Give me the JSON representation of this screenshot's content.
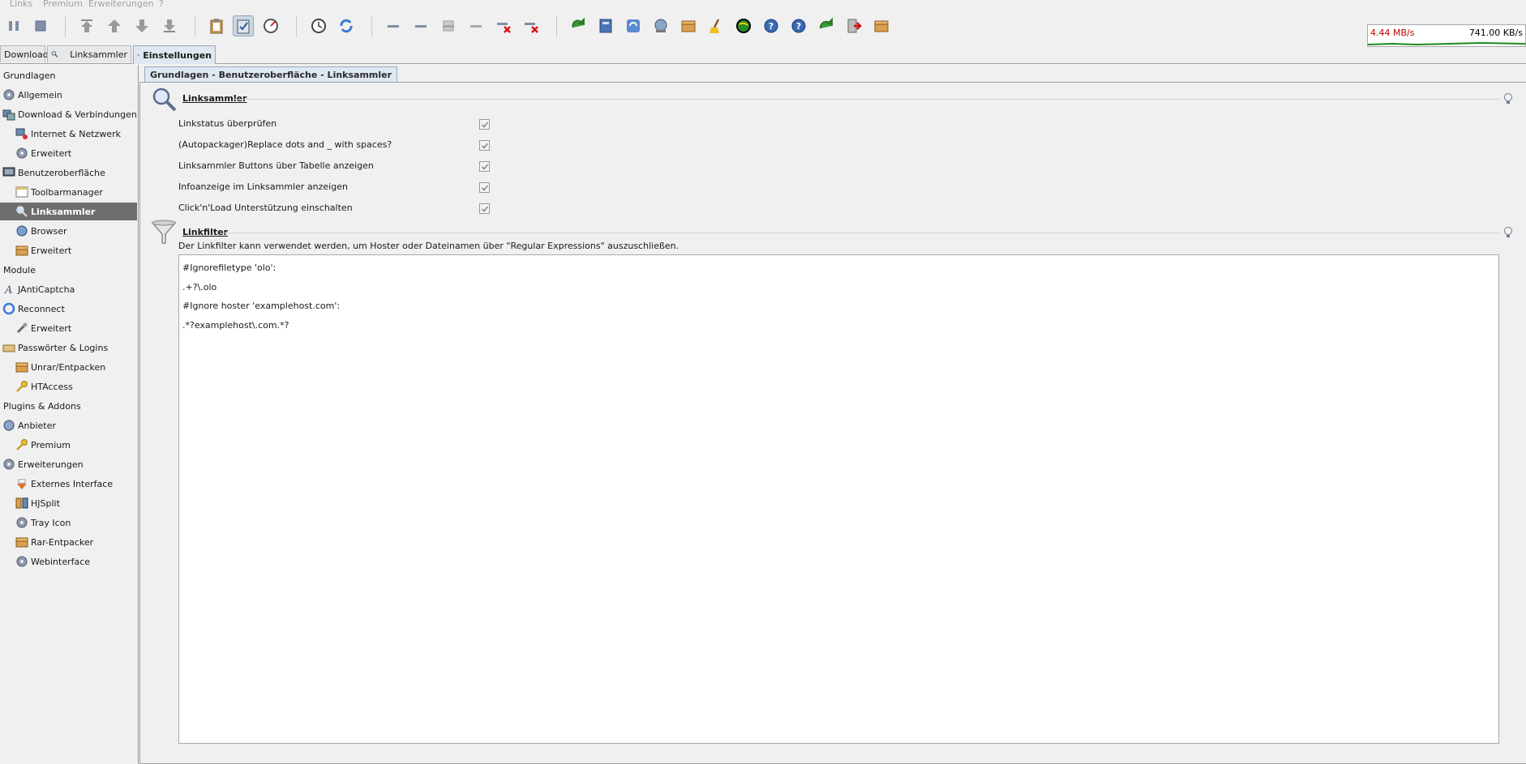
{
  "menubar": {
    "items": [
      "Links",
      "Premium",
      "Erweiterungen",
      "?"
    ]
  },
  "toolbar": {
    "buttons": [
      "pause-icon",
      "stop-icon",
      "move-top-icon",
      "move-up-icon",
      "move-down-icon",
      "move-bottom-icon",
      "clipboard-icon",
      "clipboard-monitor-icon",
      "speed-limit-icon",
      "scheduler-icon",
      "reconnect-icon",
      "remove-icon",
      "remove-finished-icon",
      "remove-packages-icon",
      "remove-failed-icon",
      "delete-icon",
      "delete-disabled-icon",
      "update-icon",
      "container-icon",
      "refresh-icon",
      "network-icon",
      "unrar-icon",
      "cleanup-icon",
      "globe-icon",
      "help-icon",
      "about-icon",
      "jump-icon",
      "exit-icon",
      "premium-box-icon"
    ]
  },
  "speed": {
    "download": "4.44 MB/s",
    "upload": "741.00 KB/s",
    "down_color": "#c00000"
  },
  "tabs": [
    {
      "label": "Download"
    },
    {
      "label": "Linksammler"
    },
    {
      "label": "Einstellungen"
    }
  ],
  "sidebar": {
    "items": [
      {
        "label": "Grundlagen",
        "icon": "category-marker"
      },
      {
        "label": "Allgemein",
        "icon": "gear-icon"
      },
      {
        "label": "Download & Verbindungen",
        "icon": "download-connections-icon"
      },
      {
        "label": "Internet & Netzwerk",
        "icon": "network-icon"
      },
      {
        "label": "Erweitert",
        "icon": "gear-icon"
      },
      {
        "label": "Benutzeroberfläche",
        "icon": "monitor-icon"
      },
      {
        "label": "Toolbarmanager",
        "icon": "window-icon"
      },
      {
        "label": "Linksammler",
        "icon": "linkgrabber-icon"
      },
      {
        "label": "Browser",
        "icon": "browser-icon"
      },
      {
        "label": "Erweitert",
        "icon": "box-icon"
      },
      {
        "label": "Module",
        "icon": "category-marker"
      },
      {
        "label": "JAntiCaptcha",
        "icon": "captcha-icon"
      },
      {
        "label": "Reconnect",
        "icon": "reconnect-icon"
      },
      {
        "label": "Erweitert",
        "icon": "tools-icon"
      },
      {
        "label": "Passwörter & Logins",
        "icon": "password-icon"
      },
      {
        "label": "Unrar/Entpacken",
        "icon": "box-icon"
      },
      {
        "label": "HTAccess",
        "icon": "key-icon"
      },
      {
        "label": "Plugins & Addons",
        "icon": "category-marker"
      },
      {
        "label": "Anbieter",
        "icon": "host-icon"
      },
      {
        "label": "Premium",
        "icon": "key-icon"
      },
      {
        "label": "Erweiterungen",
        "icon": "extensions-icon"
      },
      {
        "label": "Externes Interface",
        "icon": "external-interface-icon"
      },
      {
        "label": "HJSplit",
        "icon": "hjsplit-icon"
      },
      {
        "label": "Tray Icon",
        "icon": "gear-icon"
      },
      {
        "label": "Rar-Entpacker",
        "icon": "box-icon"
      },
      {
        "label": "Webinterface",
        "icon": "gear-icon"
      }
    ],
    "selected": "Linksammler"
  },
  "breadcrumb": "Grundlagen - Benutzeroberfläche - Linksammler",
  "section_linksammler": {
    "title": "Linksammler",
    "options": [
      {
        "label": "Linkstatus überprüfen",
        "checked": true
      },
      {
        "label": "(Autopackager)Replace dots and _ with spaces?",
        "checked": true
      },
      {
        "label": "Linksammler Buttons über Tabelle anzeigen",
        "checked": true
      },
      {
        "label": "Infoanzeige im Linksammler anzeigen",
        "checked": true
      },
      {
        "label": "Click'n'Load Unterstützung einschalten",
        "checked": true
      }
    ]
  },
  "section_linkfilter": {
    "title": "Linkfilter",
    "description": "Der Linkfilter kann verwendet werden, um Hoster oder Dateinamen über \"Regular Expressions\" auszuschließen.",
    "lines": [
      "#Ignorefiletype 'olo':",
      ".+?\\.olo",
      "#Ignore hoster 'examplehost.com':",
      ".*?examplehost\\.com.*?"
    ]
  }
}
